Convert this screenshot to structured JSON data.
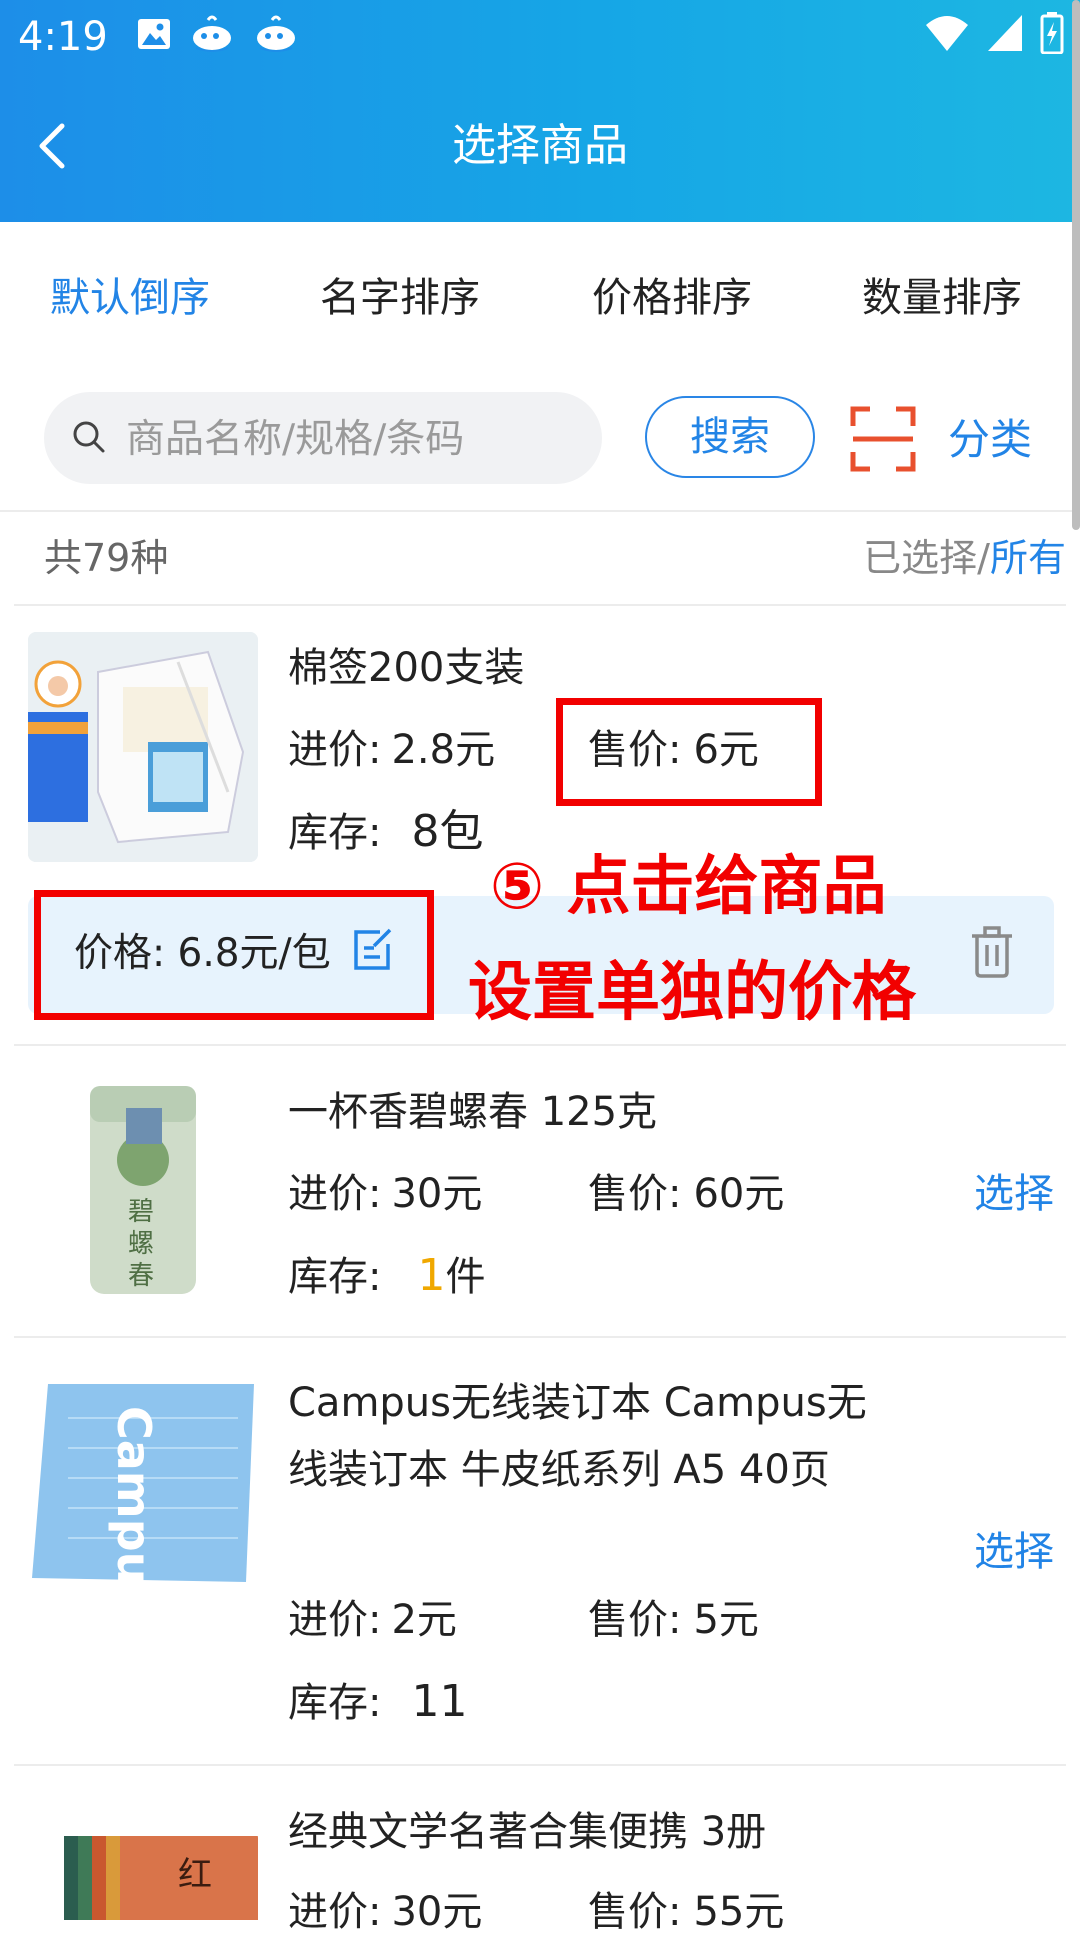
{
  "status_bar": {
    "time": "4:19"
  },
  "header": {
    "title": "选择商品"
  },
  "sort_tabs": [
    "默认倒序",
    "名字排序",
    "价格排序",
    "数量排序"
  ],
  "search": {
    "placeholder": "商品名称/规格/条码",
    "button": "搜索",
    "category": "分类"
  },
  "summary": {
    "count": "共79种",
    "selected": "已选择/",
    "all": "所有"
  },
  "products": [
    {
      "name": "棉签200支装",
      "cost_label": "进价:",
      "cost": "2.8元",
      "sale_label": "售价:",
      "sale": "6元",
      "stock_label": "库存:",
      "stock": "8包",
      "custom_price": "价格: 6.8元/包"
    },
    {
      "name": "一杯香碧螺春  125克",
      "cost_label": "进价:",
      "cost": "30元",
      "sale_label": "售价:",
      "sale": "60元",
      "stock_label": "库存:",
      "stock_num": "1",
      "stock_unit": "件",
      "action": "选择"
    },
    {
      "name": "Campus无线装订本  Campus无线装订本 牛皮纸系列 A5 40页",
      "cost_label": "进价:",
      "cost": "2元",
      "sale_label": "售价:",
      "sale": "5元",
      "stock_label": "库存:",
      "stock": "11",
      "action": "选择"
    },
    {
      "name": "经典文学名著合集便携  3册",
      "cost_label": "进价:",
      "cost": "30元",
      "sale_label": "售价:",
      "sale": "55元"
    }
  ],
  "annotation": {
    "line1": "⑤ 点击给商品",
    "line2": "设置单独的价格"
  },
  "colors": {
    "accent": "#2284e6",
    "header_start": "#1d8ee8",
    "header_end": "#1db7e2",
    "annotation": "#f20000",
    "stock_highlight": "#f0a800"
  },
  "icons": [
    "image-icon",
    "whale-icon",
    "wifi-icon",
    "signal-icon",
    "battery-icon",
    "back-icon",
    "search-icon",
    "scan-icon",
    "edit-icon",
    "trash-icon"
  ]
}
